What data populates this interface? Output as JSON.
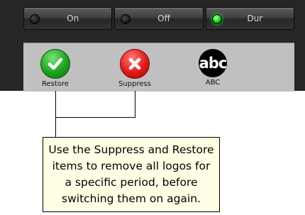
{
  "toolbar": {
    "buttons": [
      {
        "label": "On",
        "active": false
      },
      {
        "label": "Off",
        "active": false
      },
      {
        "label": "Dur",
        "active": true
      }
    ]
  },
  "logos": [
    {
      "caption": "Restore",
      "icon": "checkmark-icon",
      "color": "#1ea11e"
    },
    {
      "caption": "Suppress",
      "icon": "cross-icon",
      "color": "#e11a1a"
    },
    {
      "caption": "ABC",
      "icon": "abc-logo-icon",
      "glyph_text": "abc",
      "color": "#000000"
    }
  ],
  "callout": {
    "text": "Use the Suppress and Restore items to remove all logos for a specific period, before switching them on again."
  },
  "colors": {
    "panel_background": "#262626",
    "tray_background": "#c0c0c0",
    "active_led": "#19e319",
    "callout_background": "#ffffe6"
  }
}
